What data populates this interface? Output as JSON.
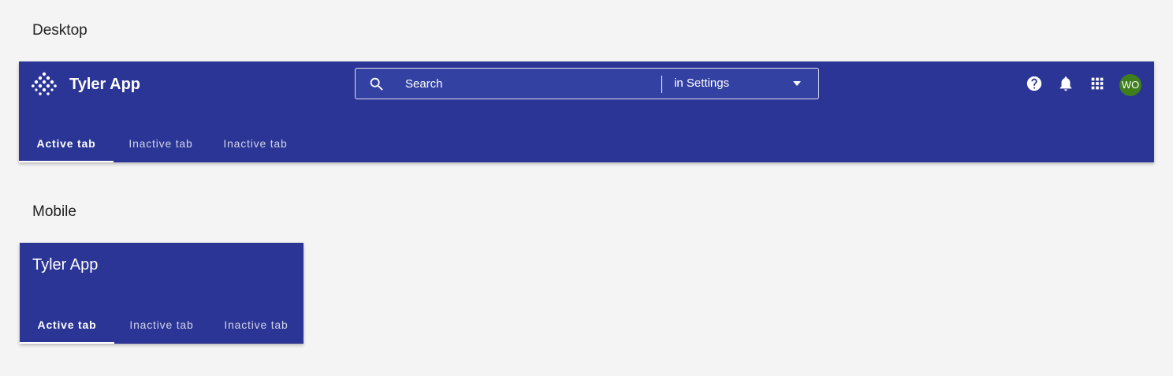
{
  "sections": {
    "desktop_label": "Desktop",
    "mobile_label": "Mobile"
  },
  "desktop": {
    "app_title": "Tyler App",
    "search": {
      "placeholder": "Search",
      "scope": "in Settings"
    },
    "actions": {
      "help_icon": "help-circle-icon",
      "notifications_icon": "bell-icon",
      "apps_icon": "apps-grid-icon",
      "avatar_initials": "WO",
      "avatar_color": "#3f7e1c"
    },
    "tabs": [
      {
        "label": "Active tab",
        "active": true
      },
      {
        "label": "Inactive tab",
        "active": false
      },
      {
        "label": "Inactive tab",
        "active": false
      }
    ]
  },
  "mobile": {
    "app_title": "Tyler App",
    "tabs": [
      {
        "label": "Active tab",
        "active": true
      },
      {
        "label": "Inactive tab",
        "active": false
      },
      {
        "label": "Inactive tab",
        "active": false
      }
    ]
  },
  "colors": {
    "appbar": "#2b3595",
    "background": "#f4f4f4"
  }
}
